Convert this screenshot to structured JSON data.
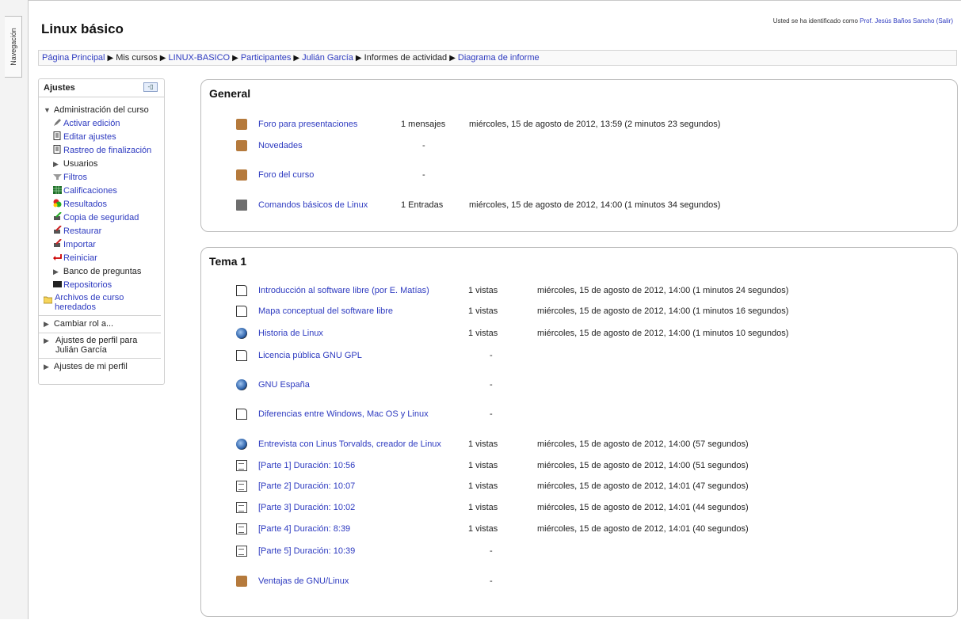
{
  "dock": {
    "tab_label": "Navegación"
  },
  "header": {
    "login_prefix": "Usted se ha identificado como",
    "login_user": "Prof. Jesús Baños Sancho",
    "login_logout": "(Salir)",
    "course_title": "Linux básico"
  },
  "breadcrumb": [
    {
      "label": "Página Principal",
      "link": true
    },
    {
      "label": "Mis cursos",
      "link": false
    },
    {
      "label": "LINUX-BASICO",
      "link": true
    },
    {
      "label": "Participantes",
      "link": true
    },
    {
      "label": "Julián García",
      "link": true
    },
    {
      "label": "Informes de actividad",
      "link": false
    },
    {
      "label": "Diagrama de informe",
      "link": true
    }
  ],
  "settings": {
    "title": "Ajustes",
    "dock_symbol": "-▯",
    "admin_label": "Administración del curso",
    "admin_items": [
      {
        "label": "Activar edición",
        "icon": "edit-icon"
      },
      {
        "label": "Editar ajustes",
        "icon": "settings-doc-icon"
      },
      {
        "label": "Rastreo de finalización",
        "icon": "completion-icon"
      },
      {
        "label": "Usuarios",
        "icon": "expand-arrow-icon"
      },
      {
        "label": "Filtros",
        "icon": "filter-icon"
      },
      {
        "label": "Calificaciones",
        "icon": "grades-icon"
      },
      {
        "label": "Resultados",
        "icon": "outcomes-icon"
      },
      {
        "label": "Copia de seguridad",
        "icon": "backup-icon"
      },
      {
        "label": "Restaurar",
        "icon": "restore-icon"
      },
      {
        "label": "Importar",
        "icon": "import-icon"
      },
      {
        "label": "Reiniciar",
        "icon": "reset-icon"
      },
      {
        "label": "Banco de preguntas",
        "icon": "expand-arrow-icon"
      },
      {
        "label": "Repositorios",
        "icon": "repository-icon"
      },
      {
        "label": "Archivos de curso heredados",
        "icon": "folder-icon"
      }
    ],
    "switch_role": "Cambiar rol a...",
    "profile_settings_for": "Ajustes de perfil para Julián García",
    "my_profile": "Ajustes de mi perfil"
  },
  "sections": {
    "general": {
      "title": "General",
      "items": [
        {
          "name": "Foro para presentaciones",
          "count": "1 mensajes",
          "date": "miércoles, 15 de agosto de 2012, 13:59 (2 minutos 23 segundos)",
          "icon": "forum-icon"
        },
        {
          "name": "Novedades",
          "count": "-",
          "date": "",
          "icon": "forum-icon"
        },
        {
          "name": "Foro del curso",
          "count": "-",
          "date": "",
          "icon": "forum-icon"
        },
        {
          "name": "Comandos básicos de Linux",
          "count": "1 Entradas",
          "date": "miércoles, 15 de agosto de 2012, 14:00 (1 minutos 34 segundos)",
          "icon": "glossary-icon"
        }
      ]
    },
    "tema1": {
      "title": "Tema 1",
      "items": [
        {
          "name": "Introducción al software libre (por E. Matías)",
          "count": "1 vistas",
          "date": "miércoles, 15 de agosto de 2012, 14:00 (1 minutos 24 segundos)",
          "icon": "page-icon"
        },
        {
          "name": "Mapa conceptual del software libre",
          "count": "1 vistas",
          "date": "miércoles, 15 de agosto de 2012, 14:00 (1 minutos 16 segundos)",
          "icon": "page-icon"
        },
        {
          "name": "Historia de Linux",
          "count": "1 vistas",
          "date": "miércoles, 15 de agosto de 2012, 14:00 (1 minutos 10 segundos)",
          "icon": "url-icon"
        },
        {
          "name": "Licencia pública GNU GPL",
          "count": "-",
          "date": "",
          "icon": "page-icon"
        },
        {
          "name": "GNU España",
          "count": "-",
          "date": "",
          "icon": "url-icon"
        },
        {
          "name": "Diferencias entre Windows, Mac OS y Linux",
          "count": "-",
          "date": "",
          "icon": "page-icon"
        },
        {
          "name": "Entrevista con Linus Torvalds, creador de Linux",
          "count": "1 vistas",
          "date": "miércoles, 15 de agosto de 2012, 14:00 (57 segundos)",
          "icon": "url-icon"
        },
        {
          "name": "[Parte 1] Duración: 10:56",
          "count": "1 vistas",
          "date": "miércoles, 15 de agosto de 2012, 14:00 (51 segundos)",
          "icon": "file-icon"
        },
        {
          "name": "[Parte 2] Duración: 10:07",
          "count": "1 vistas",
          "date": "miércoles, 15 de agosto de 2012, 14:01 (47 segundos)",
          "icon": "file-icon"
        },
        {
          "name": "[Parte 3] Duración: 10:02",
          "count": "1 vistas",
          "date": "miércoles, 15 de agosto de 2012, 14:01 (44 segundos)",
          "icon": "file-icon"
        },
        {
          "name": "[Parte 4] Duración: 8:39",
          "count": "1 vistas",
          "date": "miércoles, 15 de agosto de 2012, 14:01 (40 segundos)",
          "icon": "file-icon"
        },
        {
          "name": "[Parte 5] Duración: 10:39",
          "count": "-",
          "date": "",
          "icon": "file-icon"
        },
        {
          "name": "Ventajas de GNU/Linux",
          "count": "-",
          "date": "",
          "icon": "forum-icon"
        }
      ]
    }
  },
  "colors": {
    "link": "#2d3ac0",
    "border": "#bcbcbc"
  }
}
